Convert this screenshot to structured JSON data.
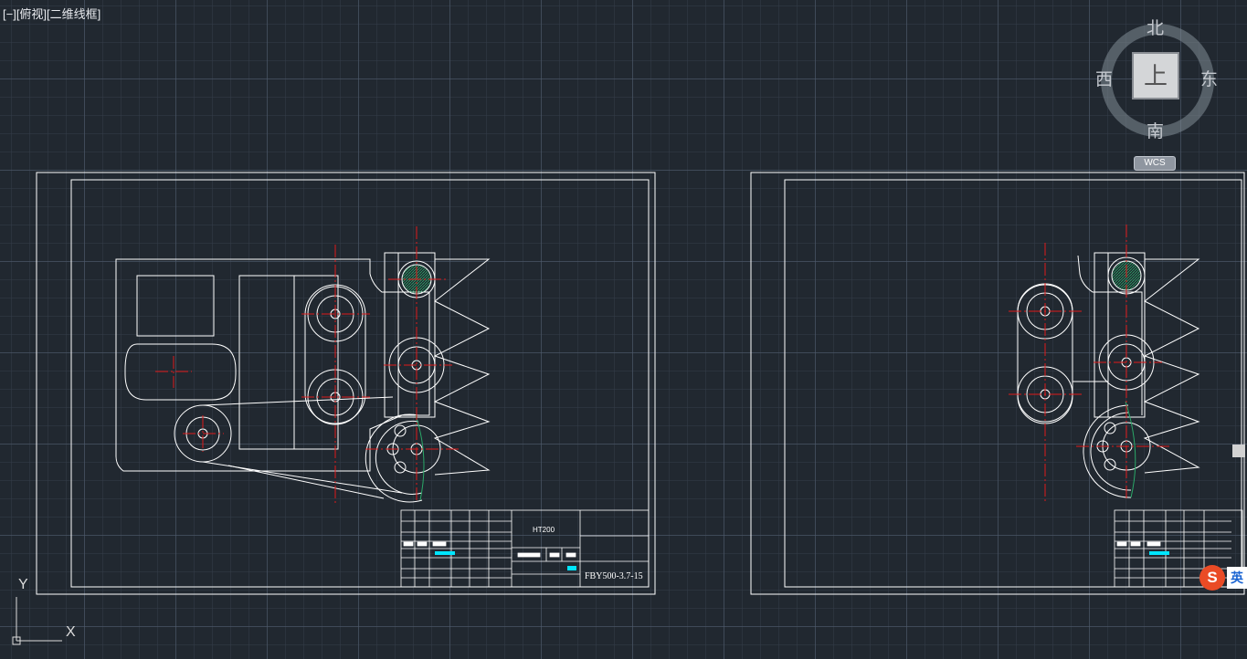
{
  "viewport": {
    "control_label": "[−][俯视][二维线框]"
  },
  "viewcube": {
    "top_face": "上",
    "north": "北",
    "south": "南",
    "west": "西",
    "east": "东",
    "wcs_label": "WCS"
  },
  "ucs": {
    "x_label": "X",
    "y_label": "Y"
  },
  "drawing": {
    "material": "HT200",
    "drawing_number": "FBY500-3.7-15",
    "title_cells": [
      "设计",
      "标准化",
      "审核",
      "工艺",
      "批准",
      "阶段标记",
      "重量",
      "比例",
      "共 张 第 张"
    ]
  },
  "ime": {
    "logo": "S",
    "lang": "英"
  },
  "colors": {
    "background": "#212830",
    "line": "#ffffff",
    "center": "#e01a1a",
    "hatch": "#2aa868",
    "accent": "#00e5ff"
  }
}
